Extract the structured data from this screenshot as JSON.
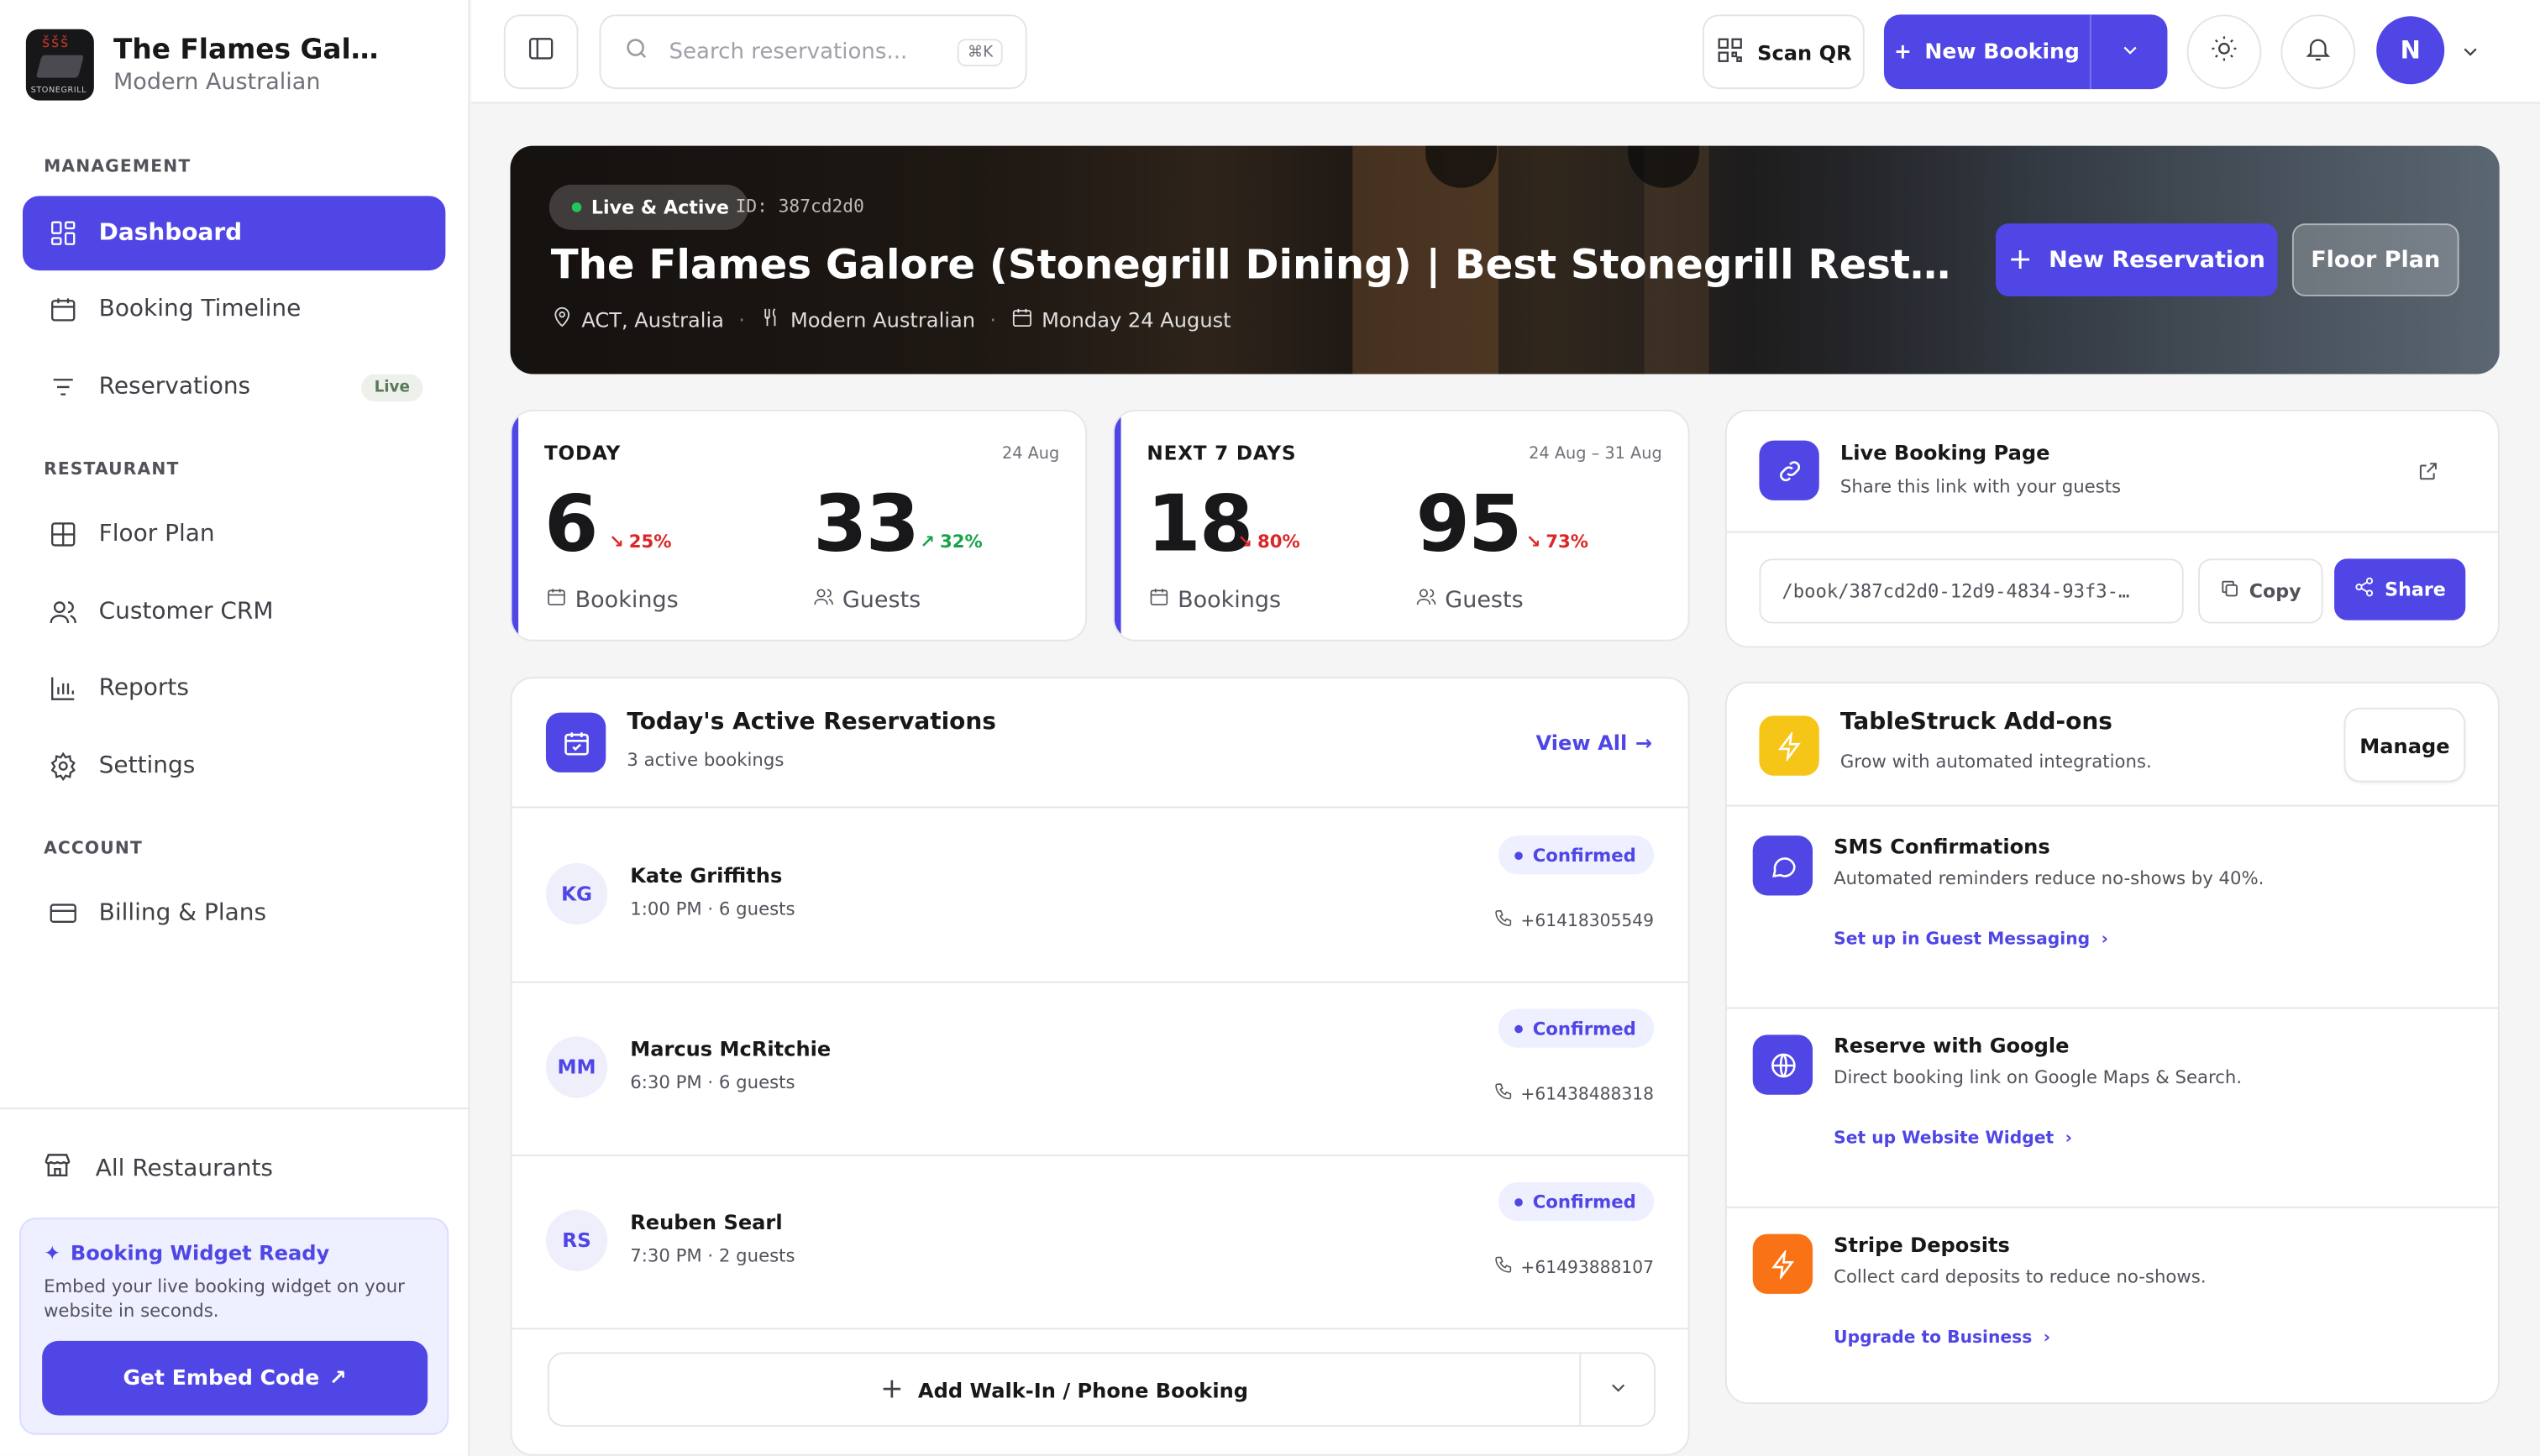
{
  "app": {
    "restaurant_name": "The Flames Galore (Stonegrill Dining)",
    "cuisine": "Modern Australian",
    "logo_text": "STONEGRILL",
    "user_initial": "N"
  },
  "sidebar": {
    "sections": {
      "management": "MANAGEMENT",
      "restaurant": "RESTAURANT",
      "account": "ACCOUNT"
    },
    "items": [
      {
        "label": "Dashboard",
        "icon": "dashboard-icon"
      },
      {
        "label": "Booking Timeline",
        "icon": "calendar-icon"
      },
      {
        "label": "Reservations",
        "icon": "list-icon",
        "badge": "Live"
      },
      {
        "label": "Floor Plan",
        "icon": "grid-icon"
      },
      {
        "label": "Customer CRM",
        "icon": "users-icon"
      },
      {
        "label": "Reports",
        "icon": "bar-chart-icon"
      },
      {
        "label": "Settings",
        "icon": "gear-icon"
      },
      {
        "label": "Billing & Plans",
        "icon": "credit-card-icon"
      }
    ],
    "all_restaurants": "All Restaurants",
    "widget": {
      "title": "Booking Widget Ready",
      "desc": "Embed your live booking widget on your website in seconds.",
      "button": "Get Embed Code"
    }
  },
  "topbar": {
    "search_placeholder": "Search reservations...",
    "search_shortcut": "⌘K",
    "scan_qr": "Scan QR",
    "new_booking": "New Booking"
  },
  "hero": {
    "status": "Live & Active",
    "id": "ID: 387cd2d0",
    "title": "The Flames Galore (Stonegrill Dining) | Best Stonegrill Restaurant in Canberra",
    "location": "ACT, Australia",
    "cuisine": "Modern Australian",
    "date": "Monday 24 August",
    "new_reservation": "New Reservation",
    "floor_plan": "Floor Plan"
  },
  "stats": {
    "today": {
      "label": "TODAY",
      "date": "24 Aug",
      "bookings": "6",
      "bookings_change": "25%",
      "bookings_label": "Bookings",
      "guests": "33",
      "guests_change": "32%",
      "guests_label": "Guests"
    },
    "week": {
      "label": "NEXT 7 DAYS",
      "date": "24 Aug – 31 Aug",
      "bookings": "18",
      "bookings_change": "80%",
      "bookings_label": "Bookings",
      "guests": "95",
      "guests_change": "73%",
      "guests_label": "Guests"
    }
  },
  "booking_page": {
    "title": "Live Booking Page",
    "subtitle": "Share this link with your guests",
    "link": "/book/387cd2d0-12d9-4834-93f3-…",
    "copy": "Copy",
    "share": "Share"
  },
  "reservations": {
    "title": "Today's Active Reservations",
    "subtitle": "3 active bookings",
    "view_all": "View All",
    "rows": [
      {
        "initials": "KG",
        "name": "Kate Griffiths",
        "meta": "1:00 PM · 6 guests",
        "status": "Confirmed",
        "phone": "+61418305549"
      },
      {
        "initials": "MM",
        "name": "Marcus McRitchie",
        "meta": "6:30 PM · 6 guests",
        "status": "Confirmed",
        "phone": "+61438488318"
      },
      {
        "initials": "RS",
        "name": "Reuben Searl",
        "meta": "7:30 PM · 2 guests",
        "status": "Confirmed",
        "phone": "+61493888107"
      }
    ],
    "add_walkin": "Add Walk-In / Phone Booking"
  },
  "addons": {
    "title": "TableStruck Add-ons",
    "subtitle": "Grow with automated integrations.",
    "manage": "Manage",
    "items": [
      {
        "title": "SMS Confirmations",
        "desc": "Automated reminders reduce no-shows by 40%.",
        "link": "Set up in Guest Messaging",
        "color": "#5046e5",
        "icon": "message-icon"
      },
      {
        "title": "Reserve with Google",
        "desc": "Direct booking link on Google Maps & Search.",
        "link": "Set up Website Widget",
        "color": "#5046e5",
        "icon": "globe-icon"
      },
      {
        "title": "Stripe Deposits",
        "desc": "Collect card deposits to reduce no-shows.",
        "link": "Upgrade to Business",
        "color": "#f97316",
        "icon": "bolt-icon"
      }
    ]
  },
  "colors": {
    "accent": "#5046e5",
    "addon_header": "#f5c518",
    "danger": "#dc2626",
    "success": "#16a34a"
  }
}
